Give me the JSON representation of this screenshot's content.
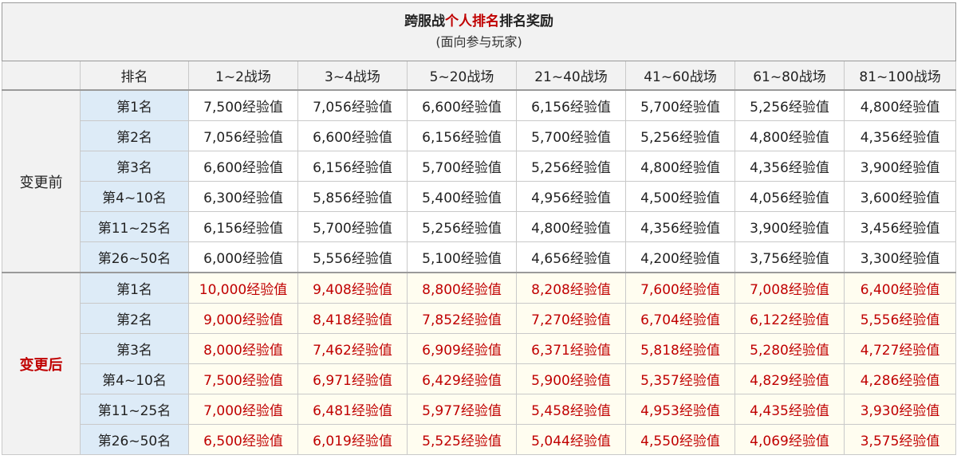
{
  "title": {
    "part1": "跨服战",
    "part2": "个人排名",
    "part3": "排名奖励",
    "subtitle": "(面向参与玩家)"
  },
  "header": {
    "rank_label": "排名",
    "columns": [
      "1~2战场",
      "3~4战场",
      "5~20战场",
      "21~40战场",
      "41~60战场",
      "61~80战场",
      "81~100战场"
    ]
  },
  "before": {
    "label": "变更前",
    "rows": [
      {
        "rank": "第1名",
        "values": [
          "7,500经验值",
          "7,056经验值",
          "6,600经验值",
          "6,156经验值",
          "5,700经验值",
          "5,256经验值",
          "4,800经验值"
        ]
      },
      {
        "rank": "第2名",
        "values": [
          "7,056经验值",
          "6,600经验值",
          "6,156经验值",
          "5,700经验值",
          "5,256经验值",
          "4,800经验值",
          "4,356经验值"
        ]
      },
      {
        "rank": "第3名",
        "values": [
          "6,600经验值",
          "6,156经验值",
          "5,700经验值",
          "5,256经验值",
          "4,800经验值",
          "4,356经验值",
          "3,900经验值"
        ]
      },
      {
        "rank": "第4~10名",
        "values": [
          "6,300经验值",
          "5,856经验值",
          "5,400经验值",
          "4,956经验值",
          "4,500经验值",
          "4,056经验值",
          "3,600经验值"
        ]
      },
      {
        "rank": "第11~25名",
        "values": [
          "6,156经验值",
          "5,700经验值",
          "5,256经验值",
          "4,800经验值",
          "4,356经验值",
          "3,900经验值",
          "3,456经验值"
        ]
      },
      {
        "rank": "第26~50名",
        "values": [
          "6,000经验值",
          "5,556经验值",
          "5,100经验值",
          "4,656经验值",
          "4,200经验值",
          "3,756经验值",
          "3,300经验值"
        ]
      }
    ]
  },
  "after": {
    "label": "变更后",
    "rows": [
      {
        "rank": "第1名",
        "values": [
          "10,000经验值",
          "9,408经验值",
          "8,800经验值",
          "8,208经验值",
          "7,600经验值",
          "7,008经验值",
          "6,400经验值"
        ]
      },
      {
        "rank": "第2名",
        "values": [
          "9,000经验值",
          "8,418经验值",
          "7,852经验值",
          "7,270经验值",
          "6,704经验值",
          "6,122经验值",
          "5,556经验值"
        ]
      },
      {
        "rank": "第3名",
        "values": [
          "8,000经验值",
          "7,462经验值",
          "6,909经验值",
          "6,371经验值",
          "5,818经验值",
          "5,280经验值",
          "4,727经验值"
        ]
      },
      {
        "rank": "第4~10名",
        "values": [
          "7,500经验值",
          "6,971经验值",
          "6,429经验值",
          "5,900经验值",
          "5,357经验值",
          "4,829经验值",
          "4,286经验值"
        ]
      },
      {
        "rank": "第11~25名",
        "values": [
          "7,000经验值",
          "6,481经验值",
          "5,977经验值",
          "5,458经验值",
          "4,953经验值",
          "4,435经验值",
          "3,930经验值"
        ]
      },
      {
        "rank": "第26~50名",
        "values": [
          "6,500经验值",
          "6,019经验值",
          "5,525经验值",
          "5,044经验值",
          "4,550经验值",
          "4,069经验值",
          "3,575经验值"
        ]
      }
    ]
  }
}
